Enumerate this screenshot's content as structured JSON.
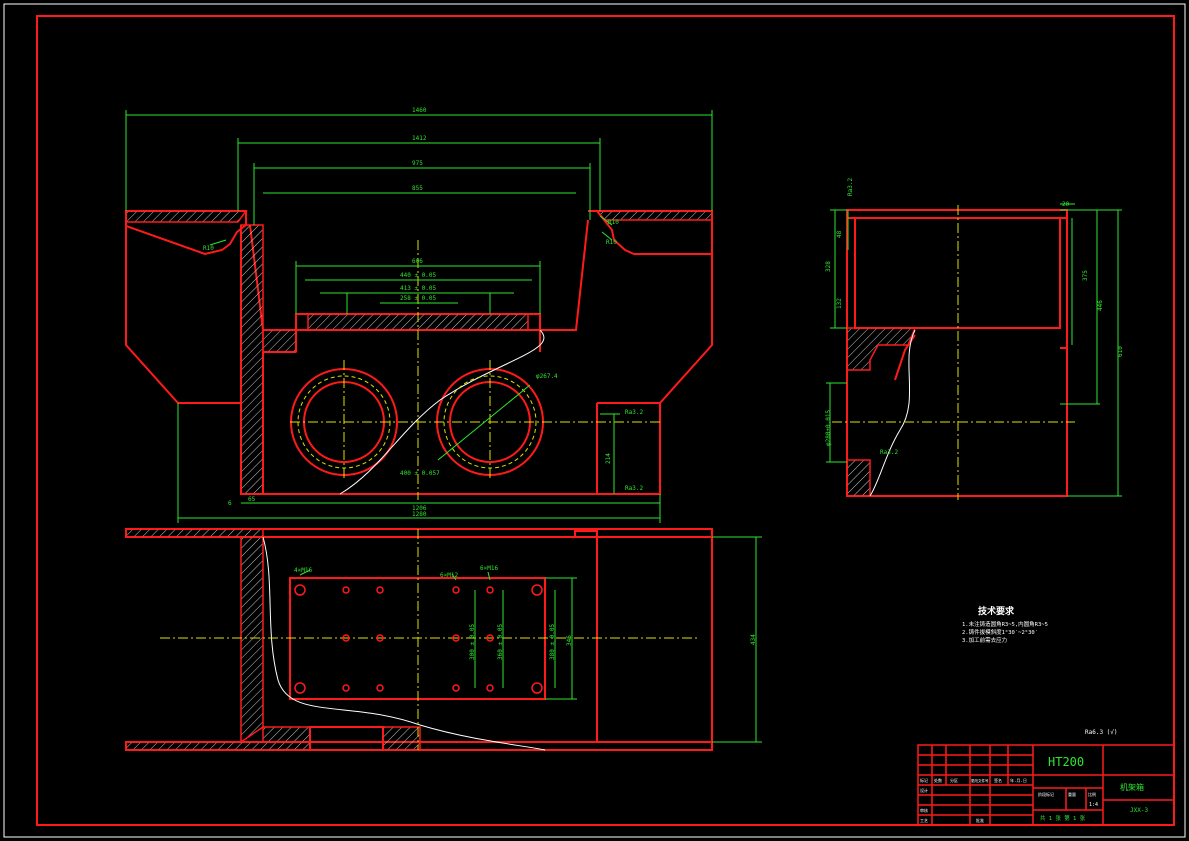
{
  "drawing": {
    "colors": {
      "background": "#000000",
      "outline": "#ff1a1a",
      "dimension": "#2ee62e",
      "hatch": "#c8c8c8",
      "centerline": "#e0e000",
      "white": "#ffffff"
    },
    "front_view": {
      "dim_overall": "1460",
      "dim_inner": "1412",
      "dim_opening": "975",
      "dim_855": "855",
      "dim_606": "606",
      "dim_440": "440 ± 0.05",
      "dim_413": "413 ± 0.05",
      "dim_258": "258 ± 0.05",
      "dim_r10_left": "R10",
      "dim_r10_right_a": "R10",
      "dim_r10_right_b": "R10",
      "dim_phi": "φ267.4",
      "dim_400": "400 ± 0.057",
      "dim_214": "214",
      "dim_ra_a": "Ra3.2",
      "dim_ra_b": "Ra3.2",
      "dim_bottom_a": "1206",
      "dim_bottom_b": "1280",
      "dim_65": "65",
      "dim_6": "6"
    },
    "side_view": {
      "dim_top": "Ra3.2",
      "dim_20": "20",
      "dim_48": "48",
      "dim_328": "328",
      "dim_132": "132",
      "dim_375": "375",
      "dim_446": "446",
      "dim_610": "610",
      "dim_bore": "φ280±0.015",
      "dim_ra": "Ra3.2"
    },
    "plan_view": {
      "dim_hole_a": "4×M16",
      "dim_hole_b": "6×M12",
      "dim_hole_c": "6×M16",
      "dim_v1": "300 ± 0.05",
      "dim_v2": "360 ± 0.05",
      "dim_v3": "380 ± 0.05",
      "dim_v4": "346",
      "dim_width": "434"
    },
    "notes": {
      "heading": "技术要求",
      "line1": "1.未注铸造圆角R3~5,内圆角R3~5",
      "line2": "2.铸件拔模斜度1°30′~2°30′",
      "line3": "3.加工前需去应力",
      "roughness": "Ra6.3 (√)"
    },
    "title_block": {
      "material": "HT200",
      "part_name": "机架箱",
      "drawing_no": "JXX-3",
      "scale": "1:4",
      "sheet": "共 1 张   第 1 张",
      "label_a": "标记",
      "label_b": "处数",
      "label_c": "分区",
      "label_d": "更改文件号",
      "label_e": "签名",
      "label_f": "年.月.日",
      "label_g": "设计",
      "label_h": "审核",
      "label_i": "工艺",
      "label_j": "批准",
      "label_k": "阶段标记",
      "label_l": "重量",
      "label_m": "比例"
    }
  }
}
